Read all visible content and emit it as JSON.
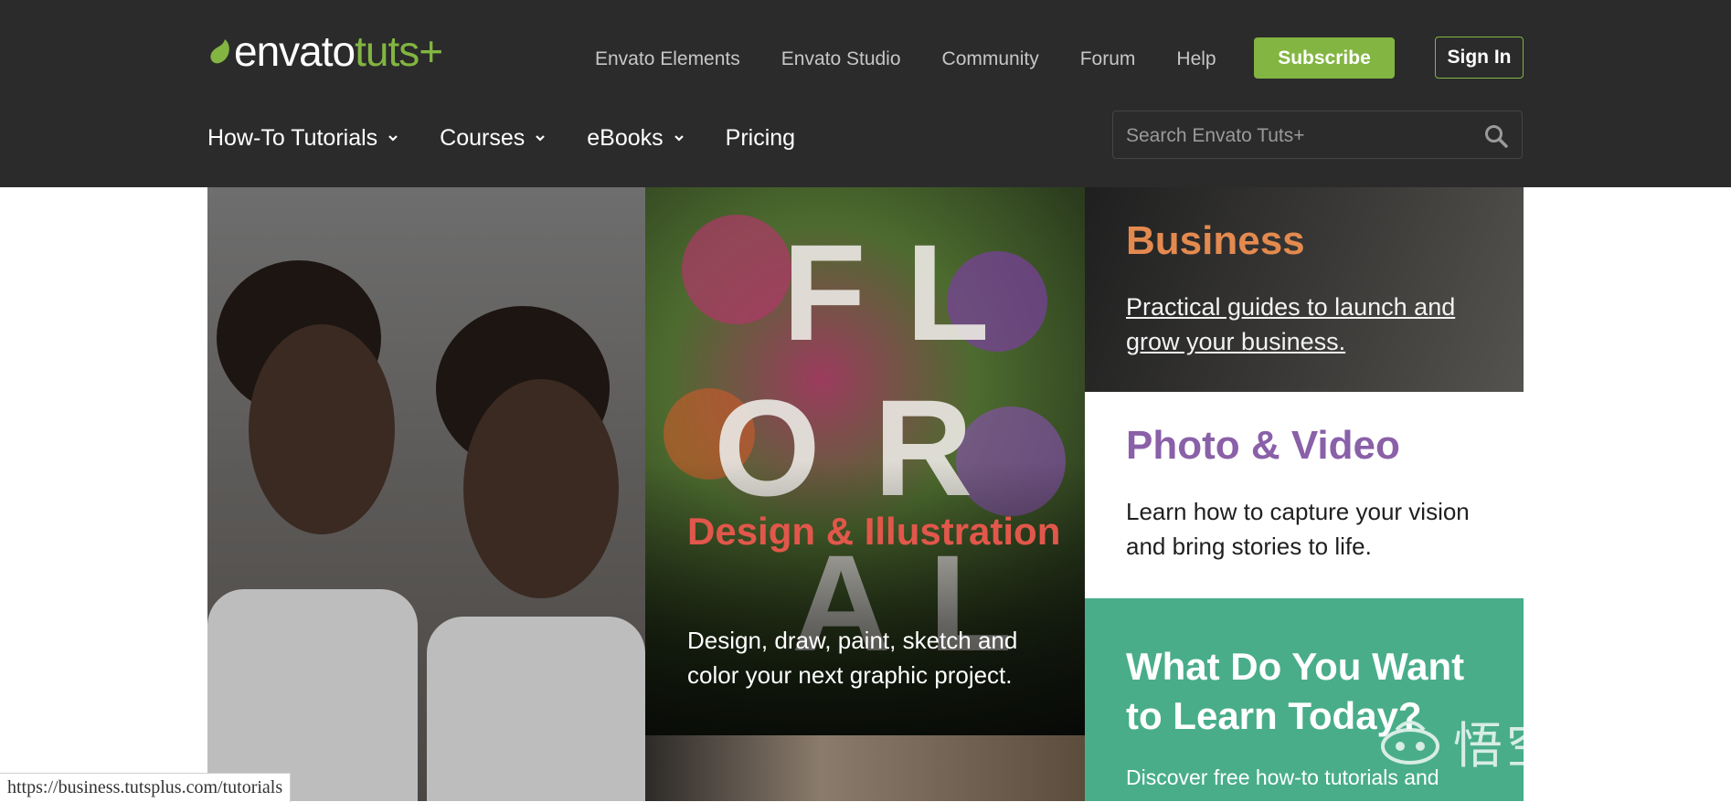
{
  "header": {
    "logo": {
      "brand": "envato",
      "product": "tuts+"
    },
    "top_nav": [
      "Envato Elements",
      "Envato Studio",
      "Community",
      "Forum",
      "Help"
    ],
    "subscribe_label": "Subscribe",
    "signin_label": "Sign In",
    "main_nav": [
      {
        "label": "How-To Tutorials",
        "has_dropdown": true
      },
      {
        "label": "Courses",
        "has_dropdown": true
      },
      {
        "label": "eBooks",
        "has_dropdown": true
      },
      {
        "label": "Pricing",
        "has_dropdown": false
      }
    ],
    "search": {
      "placeholder": "Search Envato Tuts+",
      "value": ""
    }
  },
  "tiles": {
    "design": {
      "title": "Design & Illustration",
      "description": "Design, draw, paint, sketch and color your next graphic project.",
      "letters": [
        "F",
        "L",
        "O",
        "R",
        "A",
        "L"
      ]
    },
    "business": {
      "title": "Business",
      "link": "Practical guides to launch and grow your business."
    },
    "photo_video": {
      "title": "Photo & Video",
      "description": "Learn how to capture your vision and bring stories to life."
    },
    "learn": {
      "title": "What Do You Want to Learn Today?",
      "description": "Discover free how-to tutorials and"
    }
  },
  "status_bar": {
    "url": "https://business.tutsplus.com/tutorials"
  },
  "watermark": {
    "text": "悟空问答"
  },
  "colors": {
    "header_bg": "#2b2b2b",
    "accent_green": "#82b541",
    "design_title": "#e2574b",
    "business_title": "#e48a4f",
    "photo_title": "#8a60a8",
    "learn_bg": "#49ad8a"
  }
}
